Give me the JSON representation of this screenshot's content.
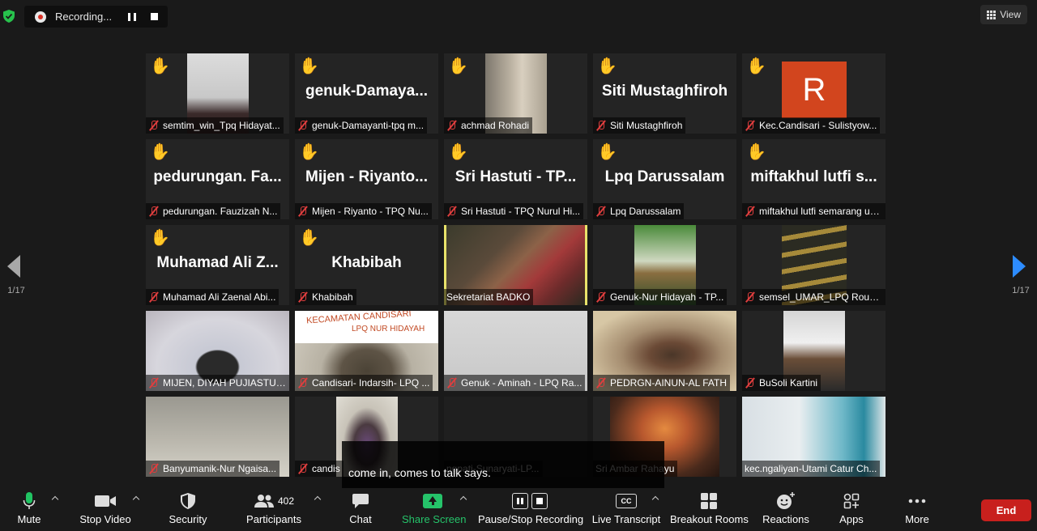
{
  "top_bar": {
    "recording_label": "Recording...",
    "view_label": "View"
  },
  "pagination": {
    "left": "1/17",
    "right": "1/17"
  },
  "tiles": [
    {
      "label": "semtim_win_Tpq Hidayat...",
      "big": "",
      "hand": true
    },
    {
      "label": "genuk-Damayanti-tpq m...",
      "big": "genuk-Damaya...",
      "hand": true
    },
    {
      "label": "achmad Rohadi",
      "big": "",
      "hand": true
    },
    {
      "label": "Siti Mustaghfiroh",
      "big": "Siti Mustaghfiroh",
      "hand": true
    },
    {
      "label": "Kec.Candisari - Sulistyow...",
      "big": "",
      "hand": true,
      "avatar": "R"
    },
    {
      "label": "pedurungan. Fauzizah N...",
      "big": "pedurungan. Fa...",
      "hand": true
    },
    {
      "label": "Mijen - Riyanto - TPQ Nu...",
      "big": "Mijen - Riyanto...",
      "hand": true
    },
    {
      "label": "Sri Hastuti - TPQ Nurul Hi...",
      "big": "Sri Hastuti - TP...",
      "hand": true
    },
    {
      "label": "Lpq Darussalam",
      "big": "Lpq Darussalam",
      "hand": true
    },
    {
      "label": "miftakhul lutfi semarang uta...",
      "big": "miftakhul lutfi s...",
      "hand": true
    },
    {
      "label": "Muhamad Ali Zaenal Abi...",
      "big": "Muhamad Ali Z...",
      "hand": true
    },
    {
      "label": "Khabibah",
      "big": "Khabibah",
      "hand": true
    },
    {
      "label": "Sekretariat BADKO",
      "big": "",
      "hand": false,
      "active": true
    },
    {
      "label": "Genuk-Nur Hidayah - TP...",
      "big": "",
      "hand": false
    },
    {
      "label": "semsel_UMAR_LPQ Roud...",
      "big": "",
      "hand": false
    },
    {
      "label": "MIJEN, DIYAH PUJIASTUT...",
      "big": "",
      "hand": false
    },
    {
      "label": "Candisari- Indarsih- LPQ ...",
      "big": "",
      "hand": false,
      "banner": [
        "KECAMATAN CANDISARI",
        "LPQ NUR HIDAYAH"
      ]
    },
    {
      "label": "Genuk - Aminah - LPQ Ra...",
      "big": "",
      "hand": false
    },
    {
      "label": "PEDRGN-AINUN-AL FATH",
      "big": "",
      "hand": false
    },
    {
      "label": "BuSoli Kartini",
      "big": "",
      "hand": false
    },
    {
      "label": "Banyumanik-Nur Ngaisa...",
      "big": "",
      "hand": false
    },
    {
      "label": "candis",
      "big": "",
      "hand": false
    },
    {
      "label": "ngpati-Sunaryati-LP...",
      "big": "",
      "hand": false,
      "nomic": true
    },
    {
      "label": "Sri Ambar Rahayu",
      "big": "",
      "hand": false,
      "nomic": true
    },
    {
      "label": "kec.ngaliyan-Utami Catur Ch...",
      "big": "",
      "hand": false,
      "nomic": true
    }
  ],
  "caption": {
    "text": "come in, comes to talk says."
  },
  "toolbar": {
    "mute": "Mute",
    "stop_video": "Stop Video",
    "security": "Security",
    "participants": "Participants",
    "participants_count": "402",
    "chat": "Chat",
    "share_screen": "Share Screen",
    "pause_stop_recording": "Pause/Stop Recording",
    "live_transcript": "Live Transcript",
    "cc": "CC",
    "breakout_rooms": "Breakout Rooms",
    "reactions": "Reactions",
    "apps": "Apps",
    "more": "More",
    "end": "End"
  },
  "colors": {
    "accent_blue": "#2d8cff",
    "share_green": "#25c36a",
    "end_red": "#c8201d",
    "active_speaker": "#e8e26a",
    "hand_yellow": "#f5c242",
    "mic_muted_red": "#e03e3e"
  }
}
